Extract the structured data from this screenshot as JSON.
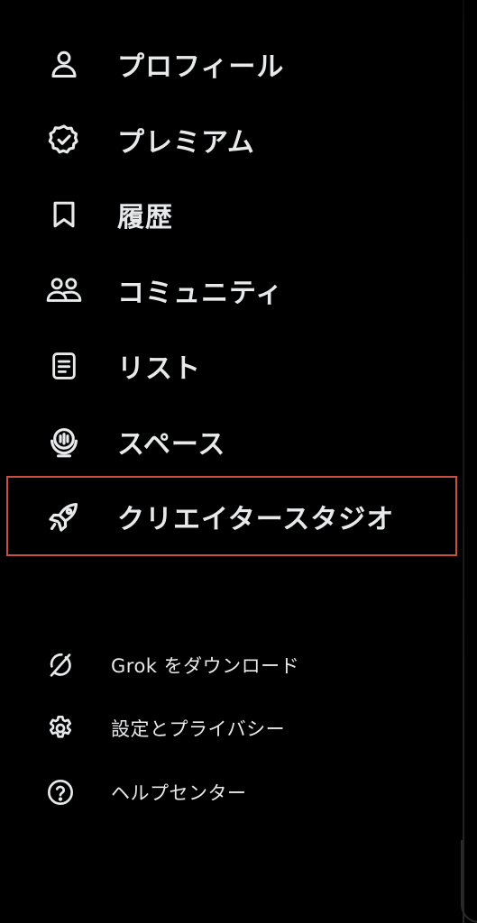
{
  "menu": {
    "items": [
      {
        "label": "プロフィール",
        "icon": "person-icon"
      },
      {
        "label": "プレミアム",
        "icon": "verified-badge-icon"
      },
      {
        "label": "履歴",
        "icon": "bookmark-icon"
      },
      {
        "label": "コミュニティ",
        "icon": "communities-icon"
      },
      {
        "label": "リスト",
        "icon": "list-document-icon"
      },
      {
        "label": "スペース",
        "icon": "spaces-microphone-icon"
      },
      {
        "label": "クリエイタースタジオ",
        "icon": "rocket-icon"
      }
    ]
  },
  "secondary": {
    "items": [
      {
        "label": "Grok をダウンロード",
        "icon": "grok-logo-icon"
      },
      {
        "label": "設定とプライバシー",
        "icon": "gear-icon"
      },
      {
        "label": "ヘルプセンター",
        "icon": "help-circle-icon"
      }
    ]
  },
  "colors": {
    "background": "#000000",
    "text": "#e7e9ea",
    "highlight_border": "#c8503c"
  }
}
